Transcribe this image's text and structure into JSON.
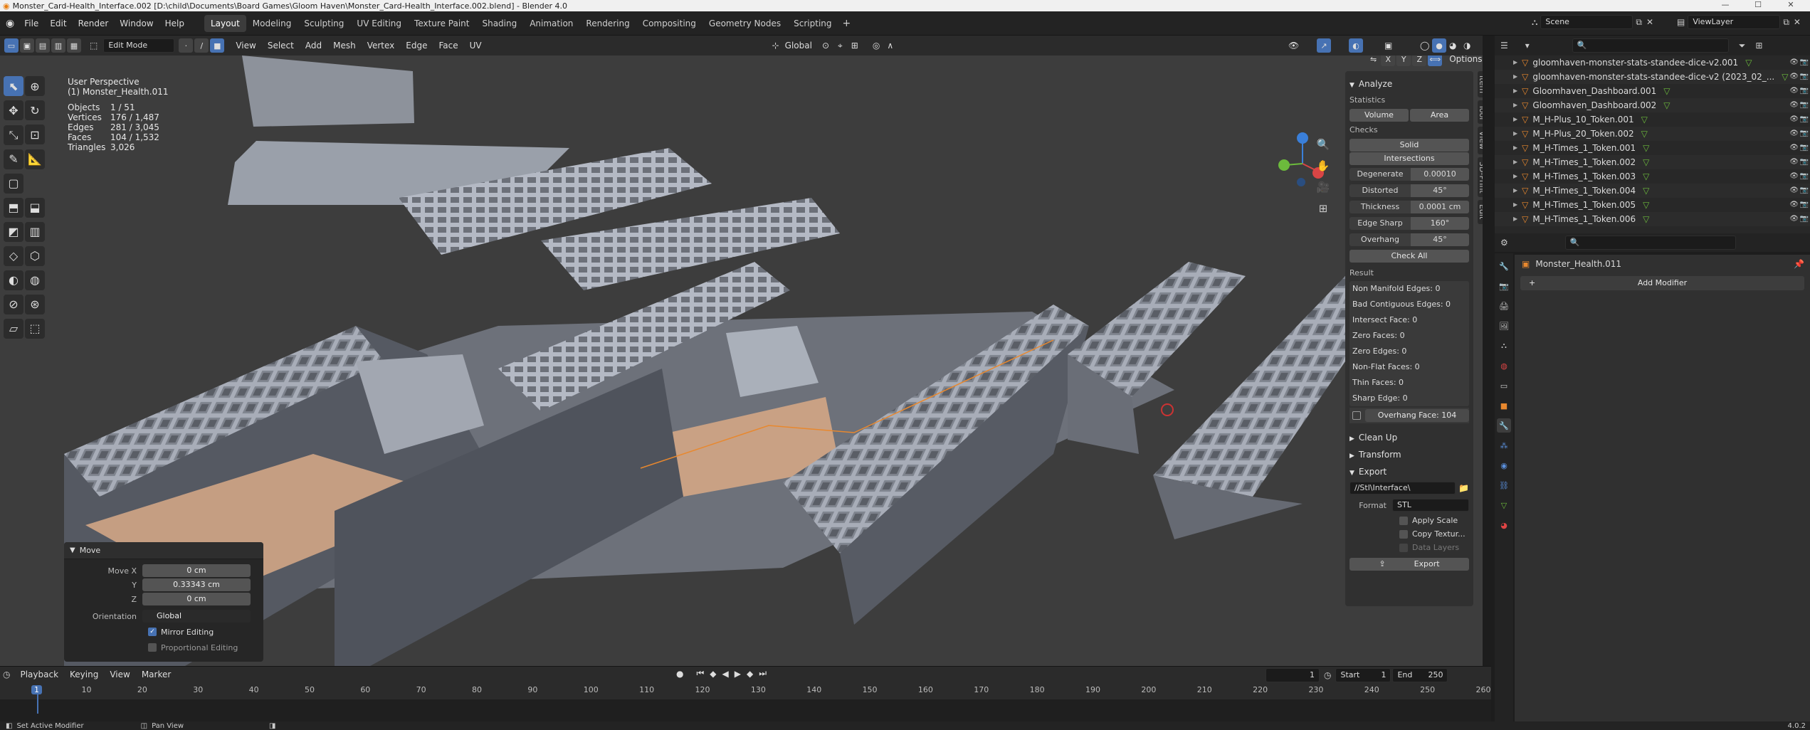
{
  "window": {
    "title": "Monster_Card-Health_Interface.002 [D:\\child\\Documents\\Board Games\\Gloom Haven\\Monster_Card-Health_Interface.002.blend] - Blender 4.0"
  },
  "menus": [
    "File",
    "Edit",
    "Render",
    "Window",
    "Help"
  ],
  "workspaces": [
    "Layout",
    "Modeling",
    "Sculpting",
    "UV Editing",
    "Texture Paint",
    "Shading",
    "Animation",
    "Rendering",
    "Compositing",
    "Geometry Nodes",
    "Scripting"
  ],
  "active_workspace": "Layout",
  "scene": "Scene",
  "view_layer": "ViewLayer",
  "viewport_header": {
    "mode": "Edit Mode",
    "items": [
      "View",
      "Select",
      "Add",
      "Mesh",
      "Vertex",
      "Edge",
      "Face",
      "UV"
    ],
    "transform_orientation": "Global",
    "options": "Options",
    "mirror_axes": [
      "X",
      "Y",
      "Z"
    ]
  },
  "viewport_info": {
    "perspective": "User Perspective",
    "object": "(1) Monster_Health.011",
    "stats": [
      {
        "label": "Objects",
        "value": "1 / 51"
      },
      {
        "label": "Vertices",
        "value": "176 / 1,487"
      },
      {
        "label": "Edges",
        "value": "281 / 3,045"
      },
      {
        "label": "Faces",
        "value": "104 / 1,532"
      },
      {
        "label": "Triangles",
        "value": "3,026"
      }
    ]
  },
  "move_panel": {
    "title": "Move",
    "move_x_label": "Move X",
    "move_x": "0 cm",
    "y_label": "Y",
    "y": "0.33343 cm",
    "z_label": "Z",
    "z": "0 cm",
    "orientation_label": "Orientation",
    "orientation": "Global",
    "mirror_editing": "Mirror Editing",
    "proportional_editing": "Proportional Editing"
  },
  "print3d": {
    "analyze": "Analyze",
    "statistics": "Statistics",
    "volume": "Volume",
    "area": "Area",
    "checks": "Checks",
    "solid": "Solid",
    "intersections": "Intersections",
    "params": [
      {
        "label": "Degenerate",
        "value": "0.00010"
      },
      {
        "label": "Distorted",
        "value": "45°"
      },
      {
        "label": "Thickness",
        "value": "0.0001 cm"
      },
      {
        "label": "Edge Sharp",
        "value": "160°"
      },
      {
        "label": "Overhang",
        "value": "45°"
      }
    ],
    "check_all": "Check All",
    "result": "Result",
    "results": [
      "Non Manifold Edges: 0",
      "Bad Contiguous Edges: 0",
      "Intersect Face: 0",
      "Zero Faces: 0",
      "Zero Edges: 0",
      "Non-Flat Faces: 0",
      "Thin Faces: 0",
      "Sharp Edge: 0"
    ],
    "overhang_result": "Overhang Face: 104",
    "clean_up": "Clean Up",
    "transform": "Transform",
    "export": "Export",
    "export_path": "//Stl\\Interface\\",
    "format_label": "Format",
    "format": "STL",
    "apply_scale": "Apply Scale",
    "copy_textures": "Copy Textur...",
    "data_layers": "Data Layers",
    "export_button": "Export",
    "vtabs": [
      "Item",
      "Tool",
      "View",
      "3D-Print",
      "Edit"
    ]
  },
  "outliner": {
    "items": [
      {
        "name": "gloomhaven-monster-stats-standee-dice-v2.001"
      },
      {
        "name": "gloomhaven-monster-stats-standee-dice-v2 (2023_02_..."
      },
      {
        "name": "Gloomhaven_Dashboard.001"
      },
      {
        "name": "Gloomhaven_Dashboard.002"
      },
      {
        "name": "M_H-Plus_10_Token.001"
      },
      {
        "name": "M_H-Plus_20_Token.002"
      },
      {
        "name": "M_H-Times_1_Token.001"
      },
      {
        "name": "M_H-Times_1_Token.002"
      },
      {
        "name": "M_H-Times_1_Token.003"
      },
      {
        "name": "M_H-Times_1_Token.004"
      },
      {
        "name": "M_H-Times_1_Token.005"
      },
      {
        "name": "M_H-Times_1_Token.006"
      }
    ]
  },
  "properties": {
    "object_name": "Monster_Health.011",
    "add_modifier": "Add Modifier"
  },
  "timeline": {
    "menus": [
      "Playback",
      "Keying",
      "View",
      "Marker"
    ],
    "current_frame": "1",
    "start_label": "Start",
    "start": "1",
    "end_label": "End",
    "end": "250",
    "ticks": [
      "1",
      "10",
      "20",
      "30",
      "40",
      "50",
      "60",
      "70",
      "80",
      "90",
      "100",
      "110",
      "120",
      "130",
      "140",
      "150",
      "160",
      "170",
      "180",
      "190",
      "200",
      "210",
      "220",
      "230",
      "240",
      "250",
      "260"
    ]
  },
  "status": {
    "left": "Set Active Modifier",
    "middle": "Pan View",
    "version": "4.0.2"
  }
}
